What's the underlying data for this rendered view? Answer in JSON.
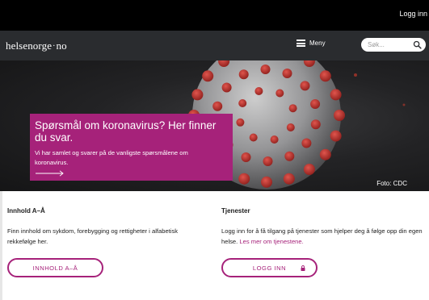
{
  "topbar": {
    "login_label": "Logg inn"
  },
  "header": {
    "logo_main": "helsenorge",
    "logo_sep": "·",
    "logo_tld": "no",
    "menu_label": "Meny",
    "search_placeholder": "Søk..."
  },
  "hero": {
    "title": "Spørsmål om koronavirus? Her finner du svar.",
    "text": "Vi har samlet og svarer på de vanligste spørsmålene om koronavirus.",
    "photo_credit": "Foto: CDC"
  },
  "sections": [
    {
      "title": "Innhold A–Å",
      "text": "Finn innhold om sykdom, forebygging og rettigheter i alfabetisk rekkefølge her.",
      "button_label": "INNHOLD A–Å"
    },
    {
      "title": "Tjenester",
      "text": "Logg inn for å få tilgang på tjenester som hjelper deg å følge opp din egen helse.",
      "link_label": "Les mer om tjenestene.",
      "button_label": "LOGG INN"
    }
  ],
  "colors": {
    "brand": "#a6227a",
    "header_bg": "#2a2c2f",
    "topbar_bg": "#000000"
  },
  "icons": [
    "menu-icon",
    "search-icon",
    "arrow-right-icon",
    "lock-icon"
  ]
}
